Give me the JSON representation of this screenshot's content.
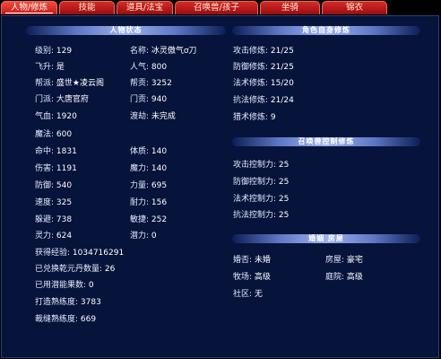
{
  "tabs": [
    {
      "label": "人物/修炼",
      "active": true
    },
    {
      "label": "技能",
      "active": false
    },
    {
      "label": "道具/法宝",
      "active": false
    },
    {
      "label": "召唤兽/孩子",
      "active": false
    },
    {
      "label": "坐骑",
      "active": false
    },
    {
      "label": "锦衣",
      "active": false
    }
  ],
  "status": {
    "title": "人物状态",
    "left": [
      {
        "label": "级别:",
        "value": "129"
      },
      {
        "label": "飞升:",
        "value": "是"
      },
      {
        "label": "帮派:",
        "value": "盛世★凌云阁"
      },
      {
        "label": "门派:",
        "value": "大唐官府"
      },
      {
        "label": "气血:",
        "value": "1920"
      },
      {
        "label": "魔法:",
        "value": "600"
      },
      {
        "label": "命中:",
        "value": "1831"
      },
      {
        "label": "伤害:",
        "value": "1191"
      },
      {
        "label": "防御:",
        "value": "540"
      },
      {
        "label": "速度:",
        "value": "325"
      },
      {
        "label": "躲避:",
        "value": "738"
      },
      {
        "label": "灵力:",
        "value": "624"
      }
    ],
    "right": [
      {
        "label": "名称:",
        "value": "冰灵傲气ơ刀"
      },
      {
        "label": "人气:",
        "value": "800"
      },
      {
        "label": "帮贡:",
        "value": "3252"
      },
      {
        "label": "门贡:",
        "value": "940"
      },
      {
        "label": "渡劫:",
        "value": "未完成"
      },
      {
        "label": "体质:",
        "value": "140"
      },
      {
        "label": "魔力:",
        "value": "140"
      },
      {
        "label": "力量:",
        "value": "695"
      },
      {
        "label": "耐力:",
        "value": "156"
      },
      {
        "label": "敏捷:",
        "value": "252"
      },
      {
        "label": "潜力:",
        "value": "0"
      }
    ],
    "extra": [
      {
        "label": "获得经验:",
        "value": "1034716291"
      },
      {
        "label": "已兑换乾元丹数量:",
        "value": "26"
      },
      {
        "label": "已用潜能果数:",
        "value": "0"
      },
      {
        "label": "打造熟练度:",
        "value": "3783"
      },
      {
        "label": "裁缝熟练度:",
        "value": "669"
      }
    ]
  },
  "cultivation": {
    "title": "角色自身修炼",
    "items": [
      {
        "label": "攻击修炼:",
        "value": "21/25"
      },
      {
        "label": "防御修炼:",
        "value": "21/25"
      },
      {
        "label": "法术修炼:",
        "value": "15/20"
      },
      {
        "label": "抗法修炼:",
        "value": "21/24"
      },
      {
        "label": "猎术修炼:",
        "value": "9"
      }
    ]
  },
  "summon_control": {
    "title": "召唤兽控制修炼",
    "items": [
      {
        "label": "攻击控制力:",
        "value": "25"
      },
      {
        "label": "防御控制力:",
        "value": "25"
      },
      {
        "label": "法术控制力:",
        "value": "25"
      },
      {
        "label": "抗法控制力:",
        "value": "25"
      }
    ]
  },
  "marriage": {
    "title": "婚姻 房屋",
    "rows": [
      [
        {
          "label": "婚否:",
          "value": "未婚"
        },
        {
          "label": "房屋:",
          "value": "豪宅"
        }
      ],
      [
        {
          "label": "牧场:",
          "value": "高级"
        },
        {
          "label": "庭院:",
          "value": "高级"
        }
      ],
      [
        {
          "label": "社区:",
          "value": "无"
        }
      ]
    ]
  }
}
